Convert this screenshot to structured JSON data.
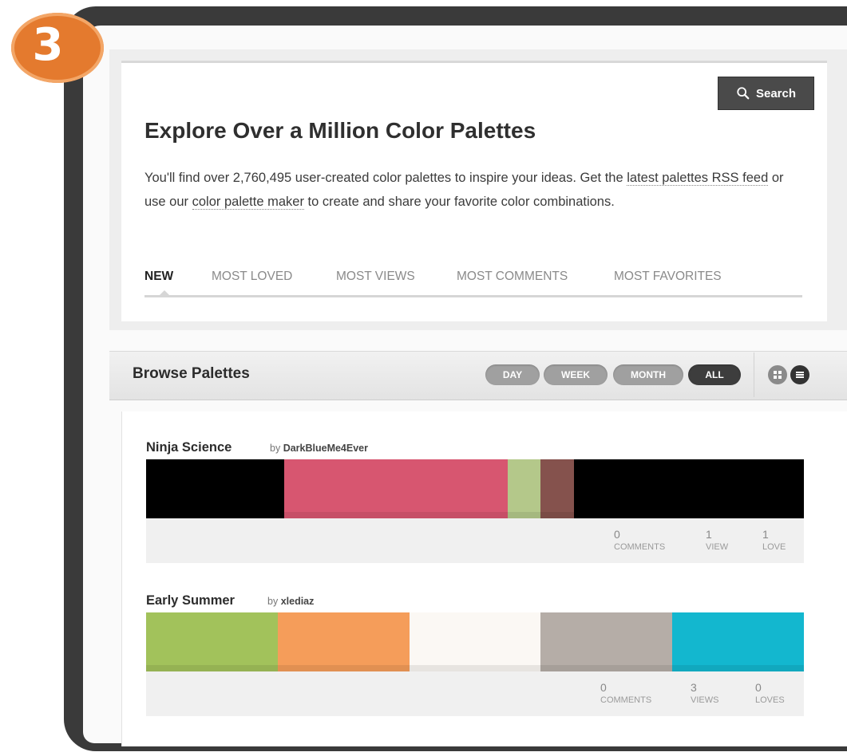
{
  "badge": {
    "number": "3"
  },
  "search": {
    "label": "Search"
  },
  "hero": {
    "title": "Explore Over a Million Color Palettes",
    "desc_part1": "You'll find over 2,760,495 user-created color palettes to inspire your ideas. Get the ",
    "link_rss": "latest palettes RSS feed",
    "desc_part2": " or use our ",
    "link_maker": "color palette maker",
    "desc_part3": " to create and share your favorite color combinations."
  },
  "tabs": [
    {
      "label": "NEW",
      "active": true
    },
    {
      "label": "MOST LOVED"
    },
    {
      "label": "MOST VIEWS"
    },
    {
      "label": "MOST COMMENTS"
    },
    {
      "label": "MOST FAVORITES"
    }
  ],
  "browse": {
    "title": "Browse Palettes",
    "filters": [
      {
        "label": "DAY"
      },
      {
        "label": "WEEK"
      },
      {
        "label": "MONTH"
      },
      {
        "label": "ALL",
        "active": true
      }
    ]
  },
  "palettes": [
    {
      "name": "Ninja Science",
      "by": "by",
      "author": "DarkBlueMe4Ever",
      "colors": [
        {
          "hex": "#000000",
          "share": 0.21
        },
        {
          "hex": "#d75670",
          "share": 0.34
        },
        {
          "hex": "#b4c88a",
          "share": 0.05
        },
        {
          "hex": "#85524d",
          "share": 0.05
        },
        {
          "hex": "#000000",
          "share": 0.35
        }
      ],
      "stats": [
        {
          "num": "0",
          "label": "COMMENTS"
        },
        {
          "num": "1",
          "label": "VIEW"
        },
        {
          "num": "1",
          "label": "LOVE"
        }
      ]
    },
    {
      "name": "Early Summer",
      "by": "by",
      "author": "xlediaz",
      "colors": [
        {
          "hex": "#a2c25b",
          "share": 0.2
        },
        {
          "hex": "#f59d5a",
          "share": 0.2
        },
        {
          "hex": "#fbf8f4",
          "share": 0.2
        },
        {
          "hex": "#b5ada7",
          "share": 0.2
        },
        {
          "hex": "#13b7cf",
          "share": 0.2
        }
      ],
      "stats": [
        {
          "num": "0",
          "label": "COMMENTS"
        },
        {
          "num": "3",
          "label": "VIEWS"
        },
        {
          "num": "0",
          "label": "LOVES"
        }
      ]
    }
  ]
}
